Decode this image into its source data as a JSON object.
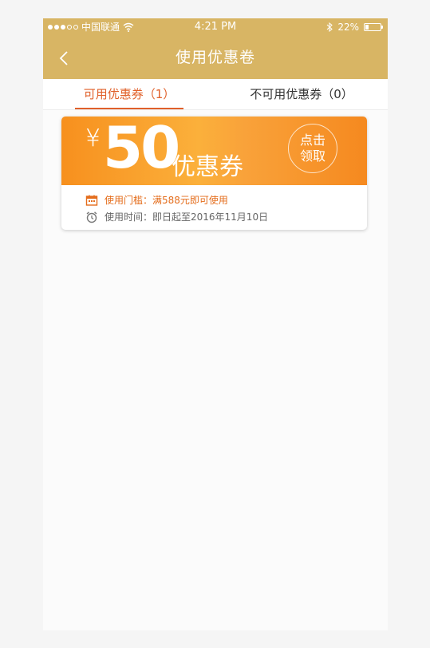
{
  "status_bar": {
    "carrier": "中国联通",
    "time": "4:21 PM",
    "battery": "22%",
    "signal_filled": 3,
    "signal_total": 5
  },
  "header": {
    "title": "使用优惠卷"
  },
  "tabs": [
    {
      "label": "可用优惠券（1）",
      "active": true
    },
    {
      "label": "不可用优惠券（0）",
      "active": false
    }
  ],
  "coupon": {
    "currency": "¥",
    "amount": "50",
    "label": "优惠券",
    "claim_label": "点击领取",
    "threshold": "使用门槛：满588元即可使用",
    "validity": "使用时间：即日起至2016年11月10日"
  },
  "colors": {
    "header_bg": "#d8b564",
    "accent": "#e0602a",
    "coupon_orange": "#f7901e"
  },
  "icons": {
    "calendar": "calendar-icon",
    "clock": "alarm-clock-icon",
    "back": "chevron-left-icon"
  }
}
